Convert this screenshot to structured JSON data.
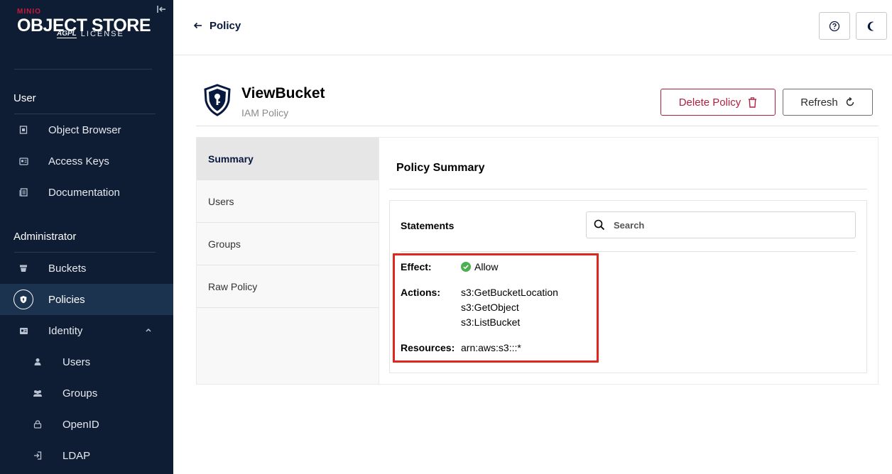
{
  "sidebar": {
    "brand_minio": "MINIO",
    "brand_title": "OBJECT STORE",
    "brand_agpl": "AGPL",
    "brand_license": "LICENSE",
    "sections": [
      {
        "title": "User"
      },
      {
        "title": "Administrator"
      }
    ],
    "user_items": [
      {
        "label": "Object Browser",
        "icon": "object-browser-icon"
      },
      {
        "label": "Access Keys",
        "icon": "access-keys-icon"
      },
      {
        "label": "Documentation",
        "icon": "documentation-icon"
      }
    ],
    "admin_items": [
      {
        "label": "Buckets",
        "icon": "buckets-icon"
      },
      {
        "label": "Policies",
        "icon": "policies-icon",
        "active": true
      },
      {
        "label": "Identity",
        "icon": "identity-icon",
        "expanded": true
      }
    ],
    "identity_items": [
      {
        "label": "Users",
        "icon": "user-icon"
      },
      {
        "label": "Groups",
        "icon": "groups-icon"
      },
      {
        "label": "OpenID",
        "icon": "openid-icon"
      },
      {
        "label": "LDAP",
        "icon": "ldap-icon"
      }
    ]
  },
  "header": {
    "back_label": "Policy"
  },
  "policy": {
    "name": "ViewBucket",
    "type": "IAM Policy",
    "delete_label": "Delete Policy",
    "refresh_label": "Refresh"
  },
  "tabs": [
    {
      "label": "Summary",
      "active": true
    },
    {
      "label": "Users"
    },
    {
      "label": "Groups"
    },
    {
      "label": "Raw Policy"
    }
  ],
  "summary": {
    "title": "Policy Summary",
    "statements_label": "Statements",
    "search_placeholder": "Search",
    "effect_label": "Effect:",
    "effect_value": "Allow",
    "actions_label": "Actions:",
    "actions": [
      "s3:GetBucketLocation",
      "s3:GetObject",
      "s3:ListBucket"
    ],
    "resources_label": "Resources:",
    "resources": "arn:aws:s3:::*"
  },
  "colors": {
    "sidebar_bg": "#0e1c34",
    "active_bg": "#1c3350",
    "danger": "#b0213f",
    "allow": "#4caf50",
    "highlight": "#e1261c"
  }
}
